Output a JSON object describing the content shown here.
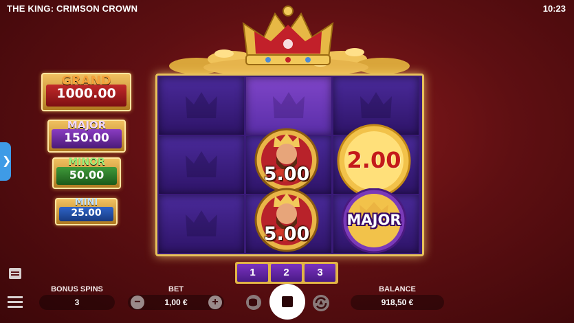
{
  "header": {
    "title": "THE KING: CRIMSON CROWN",
    "clock": "10:23"
  },
  "jackpots": {
    "grand": {
      "name": "GRAND",
      "value": "1000.00"
    },
    "major": {
      "name": "MAJOR",
      "value": "150.00"
    },
    "minor": {
      "name": "MINOR",
      "value": "50.00"
    },
    "mini": {
      "name": "MINI",
      "value": "25.00"
    }
  },
  "reels": {
    "king_coin_top": {
      "value": "5.00"
    },
    "king_coin_bottom": {
      "value": "5.00"
    },
    "gold_coin": {
      "value": "2.00"
    },
    "major_coin": {
      "label": "MAJOR"
    }
  },
  "reel_selector": {
    "options": [
      "1",
      "2",
      "3"
    ]
  },
  "footer": {
    "bonus_spins_label": "BONUS SPINS",
    "bonus_spins_value": "3",
    "bet_label": "BET",
    "bet_value": "1,00 €",
    "balance_label": "BALANCE",
    "balance_value": "918,50 €"
  },
  "colors": {
    "background": "#5e0f12",
    "frame_gold": "#e7c25a",
    "cell_purple": "#3a1a78",
    "side_tab": "#3f9be6"
  },
  "icons": {
    "side_tab": "chevron-right-icon",
    "paytable": "paytable-icon",
    "menu": "hamburger-menu-icon",
    "minus": "minus-icon",
    "plus": "plus-icon",
    "coin_stack": "coin-stack-icon",
    "stop": "stop-icon",
    "autoplay": "autoplay-icon"
  }
}
